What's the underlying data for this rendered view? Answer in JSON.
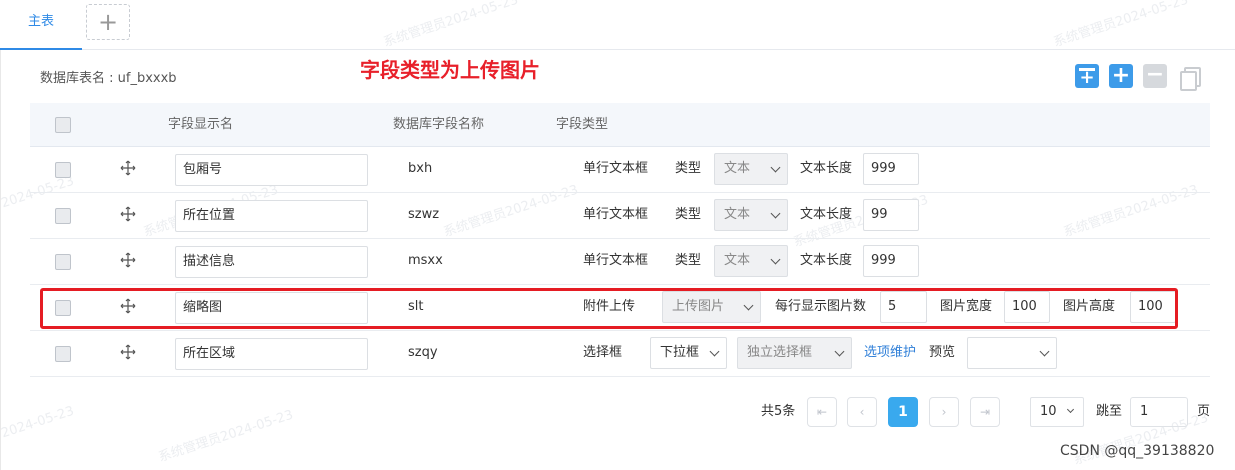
{
  "tabs": {
    "main_label": "主表",
    "add_symbol": "+"
  },
  "db": {
    "label": "数据库表名 : ",
    "value": "uf_bxxxb"
  },
  "annotation": "字段类型为上传图片",
  "toolbar": {
    "add_symbol": "+",
    "remove_symbol": "−"
  },
  "table": {
    "headers": {
      "display_name": "字段显示名",
      "db_field": "数据库字段名称",
      "field_type": "字段类型"
    },
    "rows": [
      {
        "display_name": "包厢号",
        "db_field": "bxh",
        "type_label": "单行文本框",
        "sub_type_label": "类型",
        "sub_type_value": "文本",
        "length_label": "文本长度",
        "length_value": "999"
      },
      {
        "display_name": "所在位置",
        "db_field": "szwz",
        "type_label": "单行文本框",
        "sub_type_label": "类型",
        "sub_type_value": "文本",
        "length_label": "文本长度",
        "length_value": "99"
      },
      {
        "display_name": "描述信息",
        "db_field": "msxx",
        "type_label": "单行文本框",
        "sub_type_label": "类型",
        "sub_type_value": "文本",
        "length_label": "文本长度",
        "length_value": "999"
      },
      {
        "display_name": "缩略图",
        "db_field": "slt",
        "type_label": "附件上传",
        "upload_type": "上传图片",
        "per_row_label": "每行显示图片数",
        "per_row_value": "5",
        "width_label": "图片宽度",
        "width_value": "100",
        "height_label": "图片高度",
        "height_value": "100"
      },
      {
        "display_name": "所在区域",
        "db_field": "szqy",
        "type_label": "选择框",
        "select_kind": "下拉框",
        "select_mode": "独立选择框",
        "options_link": "选项维护",
        "preview_label": "预览",
        "preview_value": ""
      }
    ]
  },
  "pager": {
    "total": "共5条",
    "first": "⇤",
    "prev": "‹",
    "current": "1",
    "next": "›",
    "last": "⇥",
    "page_size": "10",
    "jump_label": "跳至",
    "jump_value": "1",
    "page_unit": "页"
  },
  "credit": "CSDN @qq_39138820",
  "watermark": "系统管理员2024-05-23",
  "watermark_date": "2024-05-23"
}
